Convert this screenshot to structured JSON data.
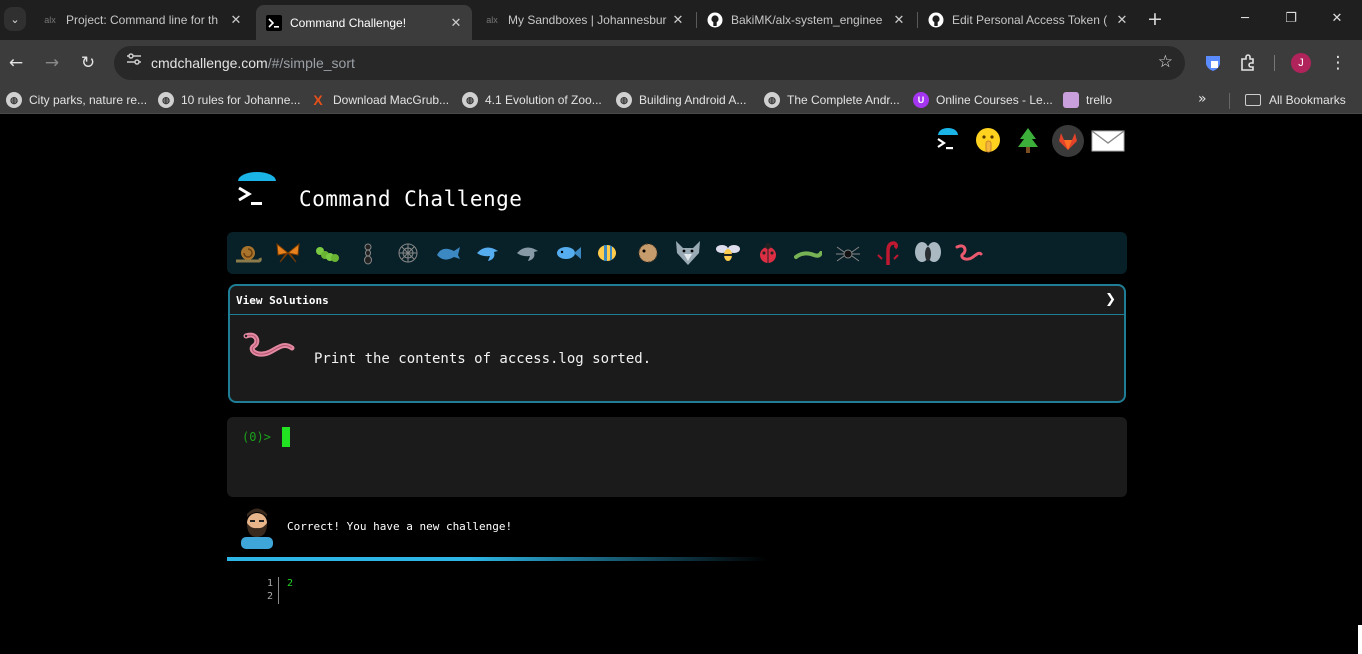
{
  "browser": {
    "tabs": [
      {
        "title": "Project: Command line for th",
        "favicon": "alx-icon",
        "active": false
      },
      {
        "title": "Command Challenge!",
        "favicon": "terminal-icon",
        "active": true
      },
      {
        "title": "My Sandboxes | Johannesbur",
        "favicon": "alx-icon",
        "active": false
      },
      {
        "title": "BakiMK/alx-system_enginee",
        "favicon": "github-icon",
        "active": false
      },
      {
        "title": "Edit Personal Access Token (",
        "favicon": "github-icon",
        "active": false
      }
    ],
    "url_host": "cmdchallenge.com",
    "url_path": "/#/simple_sort",
    "profile_initial": "J",
    "bookmarks": [
      {
        "label": "City parks, nature re...",
        "icon": "globe-icon"
      },
      {
        "label": "10 rules for Johanne...",
        "icon": "globe-icon"
      },
      {
        "label": "Download MacGrub...",
        "icon": "x-icon"
      },
      {
        "label": "4.1 Evolution of Zoo...",
        "icon": "globe-icon"
      },
      {
        "label": "Building Android A...",
        "icon": "globe-icon"
      },
      {
        "label": "The Complete Andr...",
        "icon": "globe-icon"
      },
      {
        "label": "Online Courses - Le...",
        "icon": "udemy-icon"
      },
      {
        "label": "trello",
        "icon": "trello-icon"
      }
    ],
    "all_bookmarks": "All Bookmarks"
  },
  "page": {
    "title": "Command Challenge",
    "top_icons": [
      "terminal-logo-icon",
      "shush-face-icon",
      "tree-icon",
      "gitlab-icon",
      "mail-icon"
    ],
    "levels": [
      "snail",
      "butterfly",
      "caterpillar",
      "ant",
      "web",
      "whale",
      "dolphin",
      "dolphin-gray",
      "fish",
      "tropical-fish",
      "blowfish",
      "wolf",
      "bee",
      "ladybug",
      "lizard",
      "spider",
      "scorpion",
      "fly",
      "worm"
    ],
    "view_solutions": "View Solutions",
    "challenge_text": "Print the contents of access.log sorted.",
    "prompt": "(0)>",
    "correct_message": "Correct! You have a new challenge!",
    "output_lines": [
      "1",
      "2"
    ],
    "output_text": "2"
  },
  "colors": {
    "accent": "#1f7d96",
    "prompt_green": "#22e322",
    "progress_bg": "#082028"
  }
}
